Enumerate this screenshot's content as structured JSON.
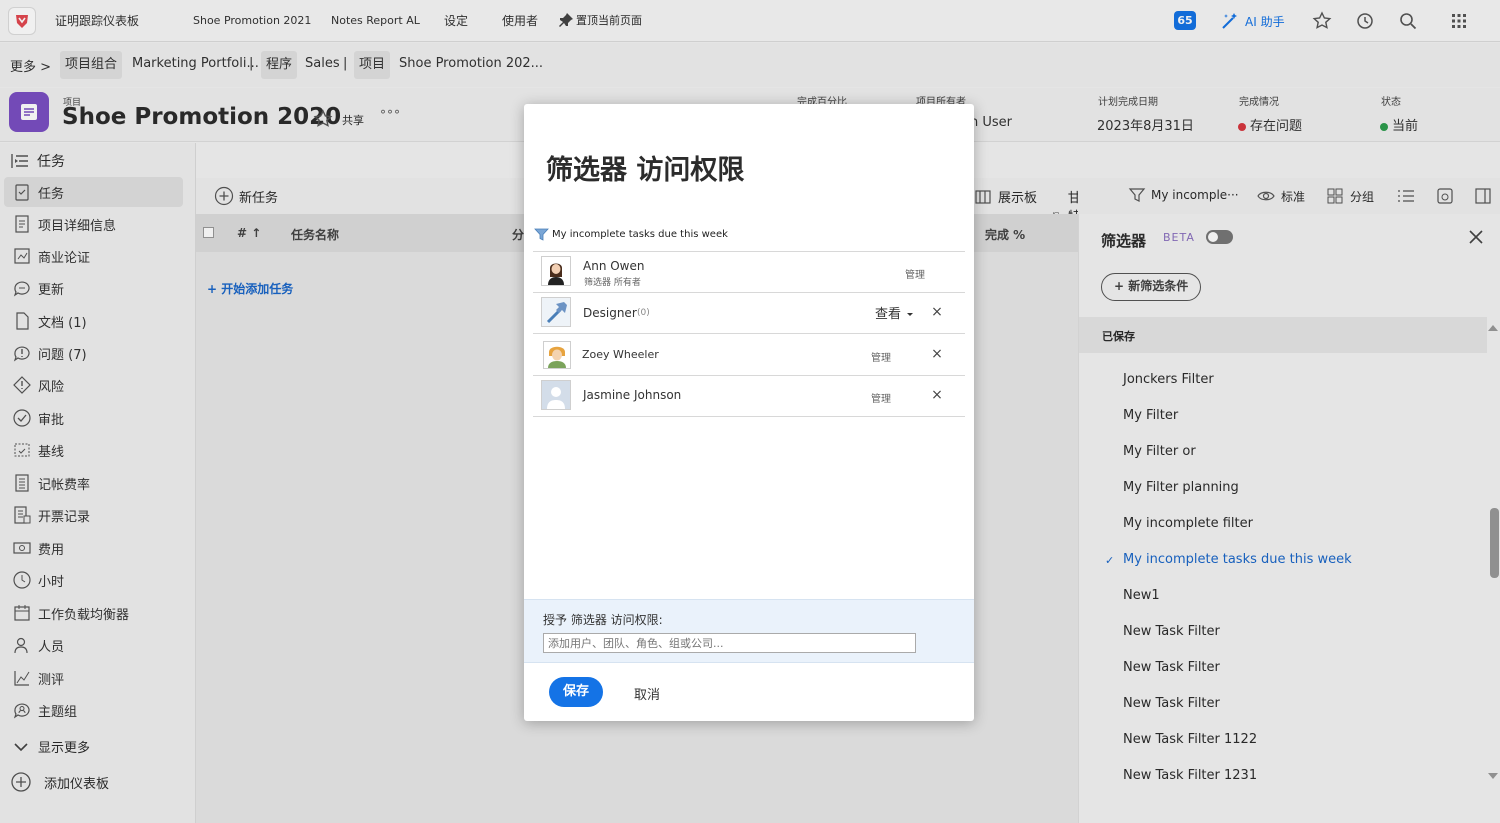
{
  "topbar": {
    "app_title": "证明跟踪仪表板",
    "tabs": [
      "Shoe Promotion 2021",
      "Notes Report AL",
      "设定",
      "使用者"
    ],
    "pin_label": "置顶当前页面",
    "notif_count": "65",
    "ai_label": "AI 助手"
  },
  "breadcrumb": {
    "more": "更多 >",
    "portfolio_tag": "项目组合",
    "portfolio": "Marketing Portfoli...",
    "sep": "|",
    "program_tag": "程序",
    "program": "Sales",
    "project_tag": "项目",
    "project": "Shoe Promotion 202..."
  },
  "project": {
    "type": "项目",
    "title": "Shoe Promotion 2020",
    "share": "共享",
    "more": "°°°",
    "meta": [
      {
        "label": "完成百分比",
        "value": ""
      },
      {
        "label": "项目所有者",
        "value": "n User"
      },
      {
        "label": "计划完成日期",
        "value": "2023年8月31日"
      },
      {
        "label": "完成情况",
        "value": "存在问题",
        "dot_color": "#d7373f"
      },
      {
        "label": "状态",
        "value": "当前",
        "dot_color": "#2d9d4d"
      }
    ]
  },
  "sidebar": {
    "header": "任务",
    "items": [
      {
        "label": "任务",
        "icon": "task-icon"
      },
      {
        "label": "项目详细信息",
        "icon": "details-icon"
      },
      {
        "label": "商业论证",
        "icon": "business-case-icon"
      },
      {
        "label": "更新",
        "icon": "comment-icon"
      },
      {
        "label": "文档 (1)",
        "icon": "document-icon"
      },
      {
        "label": "问题 (7)",
        "icon": "issue-icon"
      },
      {
        "label": "风险",
        "icon": "risk-icon"
      },
      {
        "label": "审批",
        "icon": "approval-icon"
      },
      {
        "label": "基线",
        "icon": "baseline-icon"
      },
      {
        "label": "记帐费率",
        "icon": "billing-rate-icon"
      },
      {
        "label": "开票记录",
        "icon": "invoice-icon"
      },
      {
        "label": "费用",
        "icon": "expense-icon"
      },
      {
        "label": "小时",
        "icon": "clock-icon"
      },
      {
        "label": "工作负载均衡器",
        "icon": "calendar-icon"
      },
      {
        "label": "人员",
        "icon": "people-icon"
      },
      {
        "label": "测评",
        "icon": "chart-icon"
      },
      {
        "label": "主题组",
        "icon": "topic-icon"
      }
    ],
    "show_more": "显示更多",
    "add_dashboard": "添加仪表板"
  },
  "toolbar": {
    "new_task": "新任务",
    "board": "展示板",
    "gantt": "甘特图",
    "filter": "My incomple···",
    "view": "标准",
    "group": "分组"
  },
  "table": {
    "col_num": "# ↑",
    "col_name": "任务名称",
    "col_partial": "分",
    "col_complete": "完成 %",
    "add_first": "+ 开始添加任务"
  },
  "filter_panel": {
    "title": "筛选器",
    "beta": "BETA",
    "new_condition": "+ 新筛选条件",
    "saved_header": "已保存",
    "saved": [
      "Jonckers Filter",
      "My Filter",
      "My Filter or",
      "My Filter planning",
      "My incomplete filter",
      "My incomplete tasks due this week",
      "New1",
      "New Task Filter",
      "New Task Filter",
      "New Task Filter",
      "New Task Filter 1122",
      "New Task Filter 1231"
    ],
    "selected_index": 5,
    "check": "✓"
  },
  "modal": {
    "title": "筛选器 访问权限",
    "filter_name": "My incomplete tasks due this week",
    "users": [
      {
        "name": "Ann Owen",
        "sub": "筛选器 所有者",
        "perm": "管理"
      },
      {
        "name": "Designer",
        "count": "(0)",
        "perm": "查看"
      },
      {
        "name": "Zoey Wheeler",
        "perm": "管理"
      },
      {
        "name": "Jasmine Johnson",
        "perm": "管理"
      }
    ],
    "grant_label": "授予 筛选器 访问权限:",
    "grant_placeholder": "添加用户、团队、角色、组或公司...",
    "save": "保存",
    "cancel": "取消",
    "remove": "×"
  },
  "colors": {
    "accent": "#1473e6",
    "project_icon": "#7b4fc3",
    "save_button": "#1473e6"
  }
}
